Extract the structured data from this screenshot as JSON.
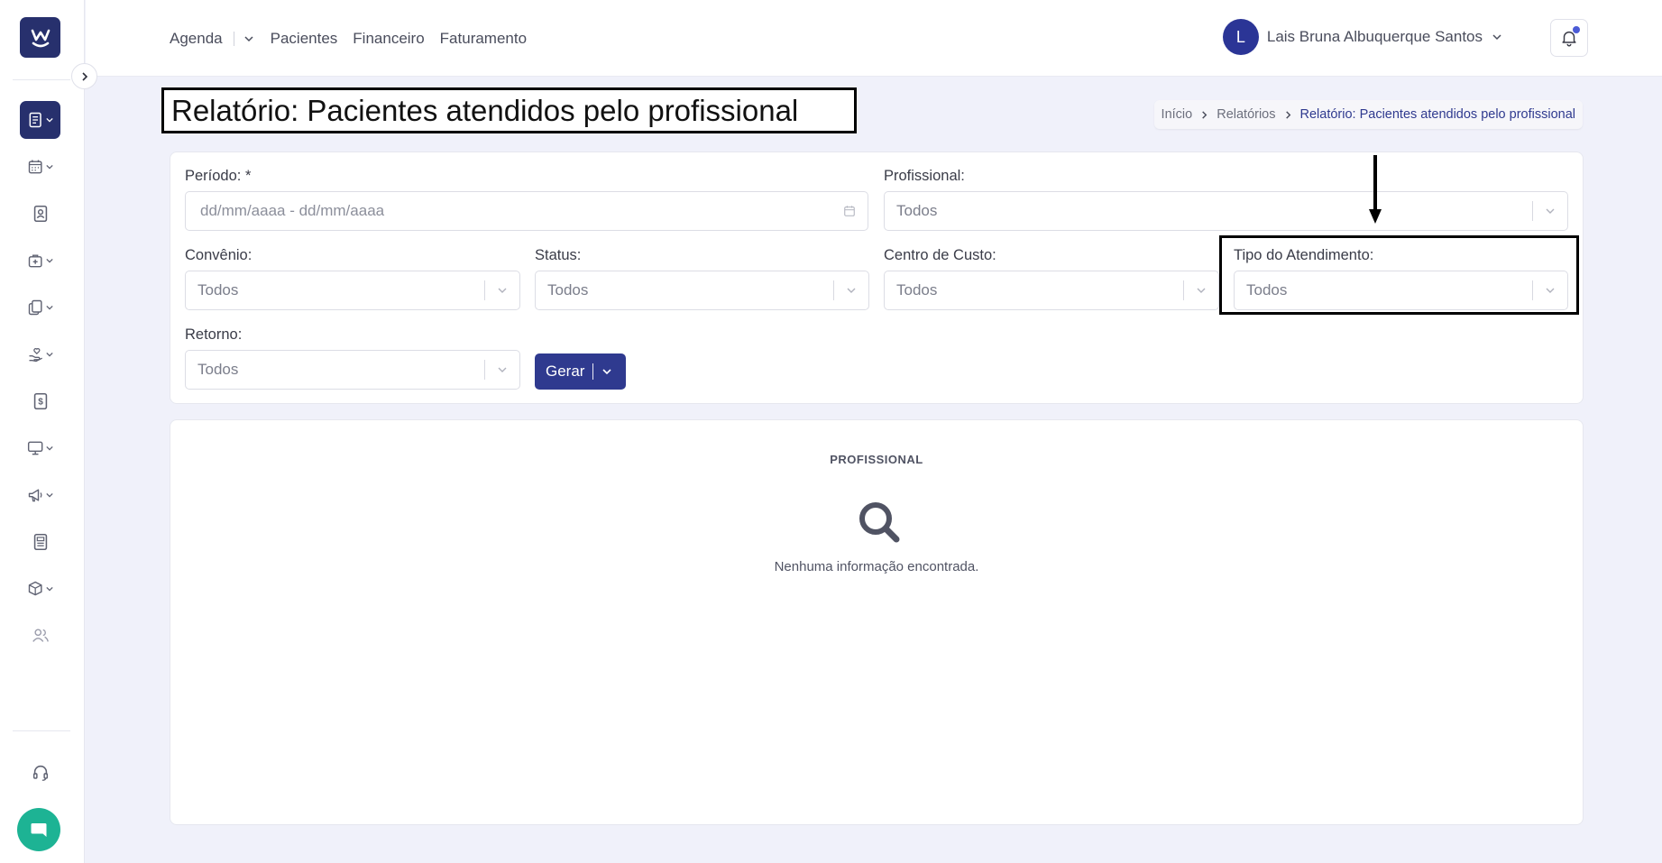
{
  "nav": {
    "items": [
      {
        "label": "Agenda"
      },
      {
        "label": "Pacientes"
      },
      {
        "label": "Financeiro"
      },
      {
        "label": "Faturamento"
      }
    ]
  },
  "user": {
    "initial": "L",
    "name": "Lais Bruna Albuquerque Santos"
  },
  "page": {
    "title": "Relatório: Pacientes atendidos pelo profissional"
  },
  "breadcrumb": {
    "items": [
      "Início",
      "Relatórios",
      "Relatório: Pacientes atendidos pelo profissional"
    ]
  },
  "filters": {
    "periodo": {
      "label": "Período: *",
      "placeholder": "dd/mm/aaaa - dd/mm/aaaa"
    },
    "profissional": {
      "label": "Profissional:",
      "value": "Todos"
    },
    "convenio": {
      "label": "Convênio:",
      "value": "Todos"
    },
    "status": {
      "label": "Status:",
      "value": "Todos"
    },
    "centro_custo": {
      "label": "Centro de Custo:",
      "value": "Todos"
    },
    "tipo_atendimento": {
      "label": "Tipo do Atendimento:",
      "value": "Todos"
    },
    "retorno": {
      "label": "Retorno:",
      "value": "Todos"
    }
  },
  "actions": {
    "gerar_label": "Gerar"
  },
  "results": {
    "column_title": "PROFISSIONAL",
    "empty_message": "Nenhuma informação encontrada."
  },
  "sidebar": {
    "icons": [
      "report-icon",
      "calendar-icon",
      "patient-card-icon",
      "medical-bag-icon",
      "documents-icon",
      "hand-heart-icon",
      "dollar-icon",
      "monitor-icon",
      "megaphone-icon",
      "newspaper-icon",
      "box-icon",
      "users-icon",
      "headset-icon",
      "chat-icon"
    ]
  },
  "colors": {
    "primary": "#2f3a8f",
    "sidebar_active": "#27306d",
    "chat": "#1db394",
    "background": "#f0f1fa"
  }
}
